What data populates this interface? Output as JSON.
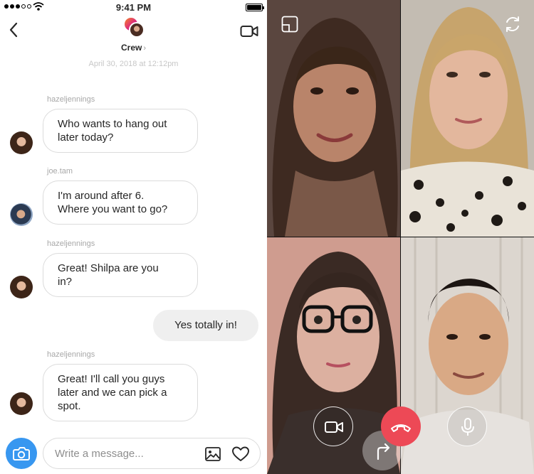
{
  "status_bar": {
    "time": "9:41 PM"
  },
  "header": {
    "group_name": "Crew",
    "chevron": "›"
  },
  "thread": {
    "timestamp": "April 30, 2018 at 12:12pm",
    "messages": [
      {
        "sender": "hazeljennings",
        "text_lines": [
          "Who wants to hang out",
          "later today?"
        ]
      },
      {
        "sender": "joe.tam",
        "text_lines": [
          "I'm around after 6.",
          "Where you want to go?"
        ]
      },
      {
        "sender": "hazeljennings",
        "text_lines": [
          "Great! Shilpa are you",
          "in?"
        ]
      },
      {
        "sender": "",
        "text_lines": [
          "Yes totally in!"
        ]
      },
      {
        "sender": "hazeljennings",
        "text_lines": [
          "Great! I'll call you guys",
          "later and we can pick a",
          "spot."
        ]
      }
    ]
  },
  "composer": {
    "placeholder": "Write a message..."
  },
  "colors": {
    "accent_blue": "#3897f0",
    "hangup_red": "#ed4956",
    "bubble_border": "#dbdbdb",
    "own_bubble": "#efefef"
  },
  "icons": {
    "back": "chevron-left-icon",
    "video": "video-camera-icon",
    "camera": "camera-icon",
    "gallery": "image-icon",
    "like": "heart-icon",
    "pip": "picture-in-picture-icon",
    "flip": "flip-camera-icon",
    "call_video": "video-toggle-icon",
    "hangup": "end-call-icon",
    "mic": "microphone-icon",
    "share": "share-arrow-icon"
  }
}
